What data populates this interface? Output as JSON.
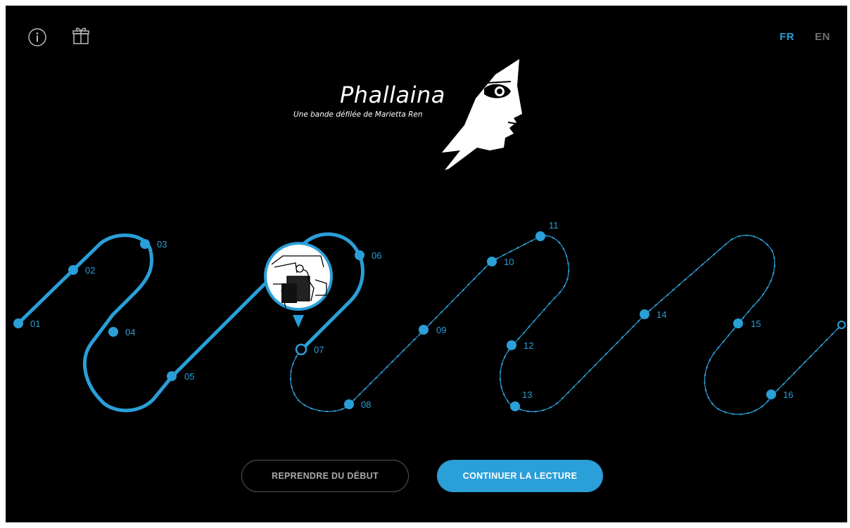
{
  "header": {
    "info_icon": "info-circle-icon",
    "gift_icon": "gift-icon",
    "languages": [
      {
        "code": "FR",
        "active": true
      },
      {
        "code": "EN",
        "active": false
      }
    ]
  },
  "logo": {
    "title": "Phallaina",
    "subtitle": "Une bande défilée de Marietta Ren",
    "image": "profile-face-logo"
  },
  "timeline": {
    "current_chapter": "07",
    "chapters": [
      "01",
      "02",
      "03",
      "04",
      "05",
      "06",
      "07",
      "08",
      "09",
      "10",
      "11",
      "12",
      "13",
      "14",
      "15",
      "16"
    ]
  },
  "actions": {
    "restart_label": "REPRENDRE DU DÉBUT",
    "continue_label": "CONTINUER LA LECTURE"
  },
  "colors": {
    "accent": "#2a9fd8",
    "background": "#000000"
  }
}
